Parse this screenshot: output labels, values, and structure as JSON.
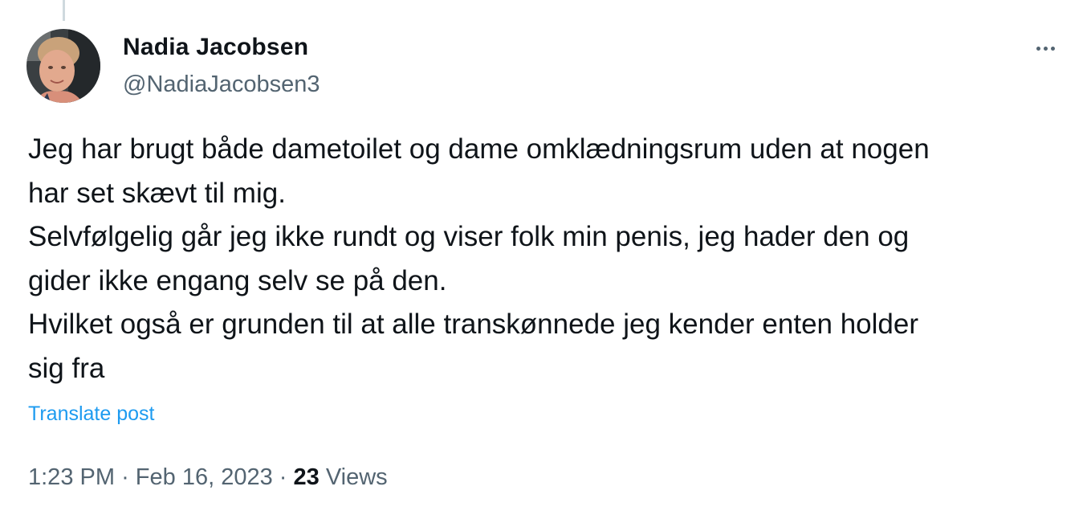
{
  "post": {
    "author": {
      "display_name": "Nadia Jacobsen",
      "handle": "@NadiaJacobsen3",
      "avatar_icon": "profile-photo"
    },
    "more_icon": "more-horizontal-icon",
    "body_lines": [
      "Jeg har brugt både dametoilet og dame omklædningsrum uden at nogen",
      "har set skævt til mig.",
      "Selvfølgelig går jeg ikke rundt og viser folk min penis, jeg hader den og",
      "gider ikke engang selv se på den.",
      "Hvilket også er grunden til at alle transkønnede jeg kender enten holder",
      "sig fra"
    ],
    "translate_label": "Translate post",
    "time": "1:23 PM",
    "date": "Feb 16, 2023",
    "separator": "·",
    "views_count": "23",
    "views_label": "Views"
  },
  "colors": {
    "text_primary": "#0f1419",
    "text_secondary": "#536471",
    "link": "#1d9bf0",
    "thread_line": "#cfd9de"
  }
}
